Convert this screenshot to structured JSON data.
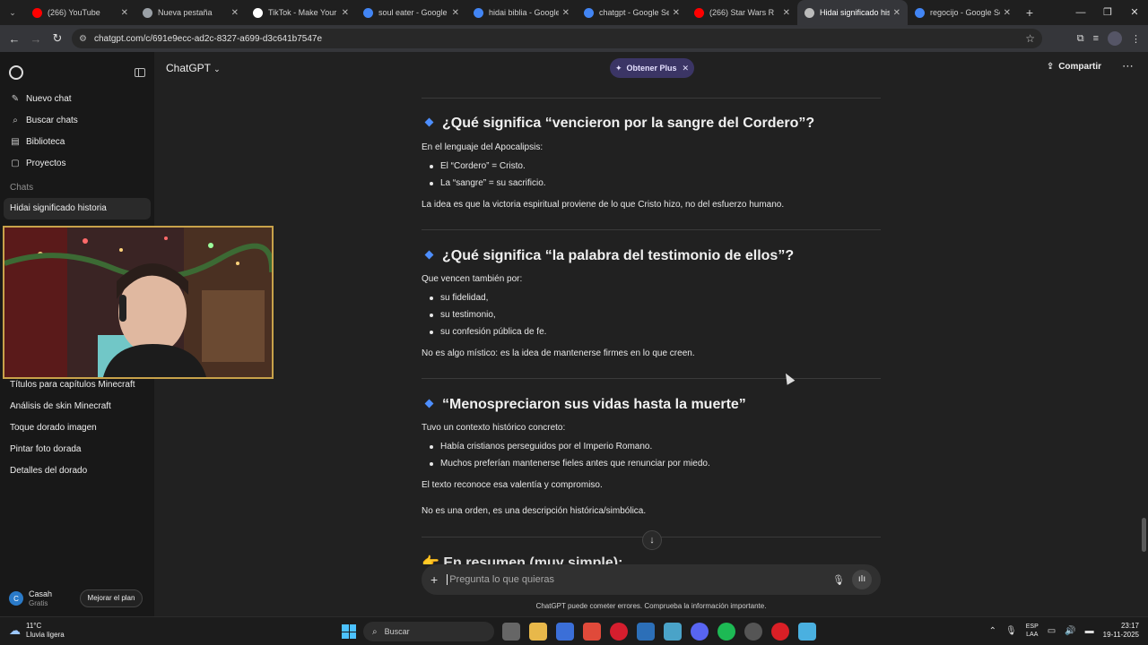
{
  "browser": {
    "tabs": [
      {
        "title": "(266) YouTube",
        "favicon_color": "#ff0000",
        "active": false
      },
      {
        "title": "Nueva pestaña",
        "favicon_color": "#9aa0a6",
        "active": false
      },
      {
        "title": "TikTok - Make Your D",
        "favicon_color": "#ffffff",
        "active": false
      },
      {
        "title": "soul eater - Google S",
        "favicon_color": "#4285f4",
        "active": false
      },
      {
        "title": "hidai biblia - Google",
        "favicon_color": "#4285f4",
        "active": false
      },
      {
        "title": "chatgpt - Google Sea",
        "favicon_color": "#4285f4",
        "active": false
      },
      {
        "title": "(266) Star Wars R",
        "favicon_color": "#ff0000",
        "active": false
      },
      {
        "title": "Hidai significado hist",
        "favicon_color": "#bbbbbb",
        "active": true
      },
      {
        "title": "regocijo - Google Sea",
        "favicon_color": "#4285f4",
        "active": false
      }
    ],
    "url": "chatgpt.com/c/691e9ecc-ad2c-8327-a699-d3c641b7547e"
  },
  "sidebar": {
    "nav": [
      {
        "label": "Nuevo chat",
        "icon": "edit-icon"
      },
      {
        "label": "Buscar chats",
        "icon": "search-icon"
      },
      {
        "label": "Biblioteca",
        "icon": "library-icon"
      },
      {
        "label": "Proyectos",
        "icon": "folder-icon"
      }
    ],
    "section_label": "Chats",
    "chats_top": [
      "Hidai significado historia"
    ],
    "chats_bottom": [
      "Títulos para capítulos Minecraft",
      "Análisis de skin Minecraft",
      "Toque dorado imagen",
      "Pintar foto dorada",
      "Detalles del dorado"
    ],
    "user": {
      "initial": "C",
      "name": "Casah",
      "plan": "Gratis",
      "upgrade_label": "Mejorar el plan"
    }
  },
  "header": {
    "model": "ChatGPT",
    "plus_label": "Obtener Plus",
    "share_label": "Compartir"
  },
  "message": {
    "sections": [
      {
        "heading": "¿Qué significa “vencieron por la sangre del Cordero”?",
        "intro": "En el lenguaje del Apocalipsis:",
        "bullets": [
          "El “Cordero” = Cristo.",
          "La “sangre” = su sacrificio."
        ],
        "outro": [
          "La idea es que la victoria espiritual proviene de lo que Cristo hizo, no del esfuerzo humano."
        ]
      },
      {
        "heading": "¿Qué significa “la palabra del testimonio de ellos”?",
        "intro": "Que vencen también por:",
        "bullets": [
          "su fidelidad,",
          "su testimonio,",
          "su confesión pública de fe."
        ],
        "outro": [
          "No es algo místico: es la idea de mantenerse firmes en lo que creen."
        ]
      },
      {
        "heading": "“Menospreciaron sus vidas hasta la muerte”",
        "intro": "Tuvo un contexto histórico concreto:",
        "bullets": [
          "Había cristianos perseguidos por el Imperio Romano.",
          "Muchos preferían mantenerse fieles antes que renunciar por miedo."
        ],
        "outro": [
          "El texto reconoce esa valentía y compromiso.",
          "No es una orden, es una descripción histórica/simbólica."
        ]
      }
    ],
    "cut_heading": "👉 En resumen (muy simple):"
  },
  "composer": {
    "placeholder": "Pregunta lo que quieras",
    "disclaimer": "ChatGPT puede cometer errores. Comprueba la información importante."
  },
  "taskbar": {
    "temp": "11°C",
    "weather": "Lluvia ligera",
    "search_placeholder": "Buscar",
    "lang_top": "ESP",
    "lang_bottom": "LAA",
    "time": "23:17",
    "date": "19-11-2025"
  }
}
